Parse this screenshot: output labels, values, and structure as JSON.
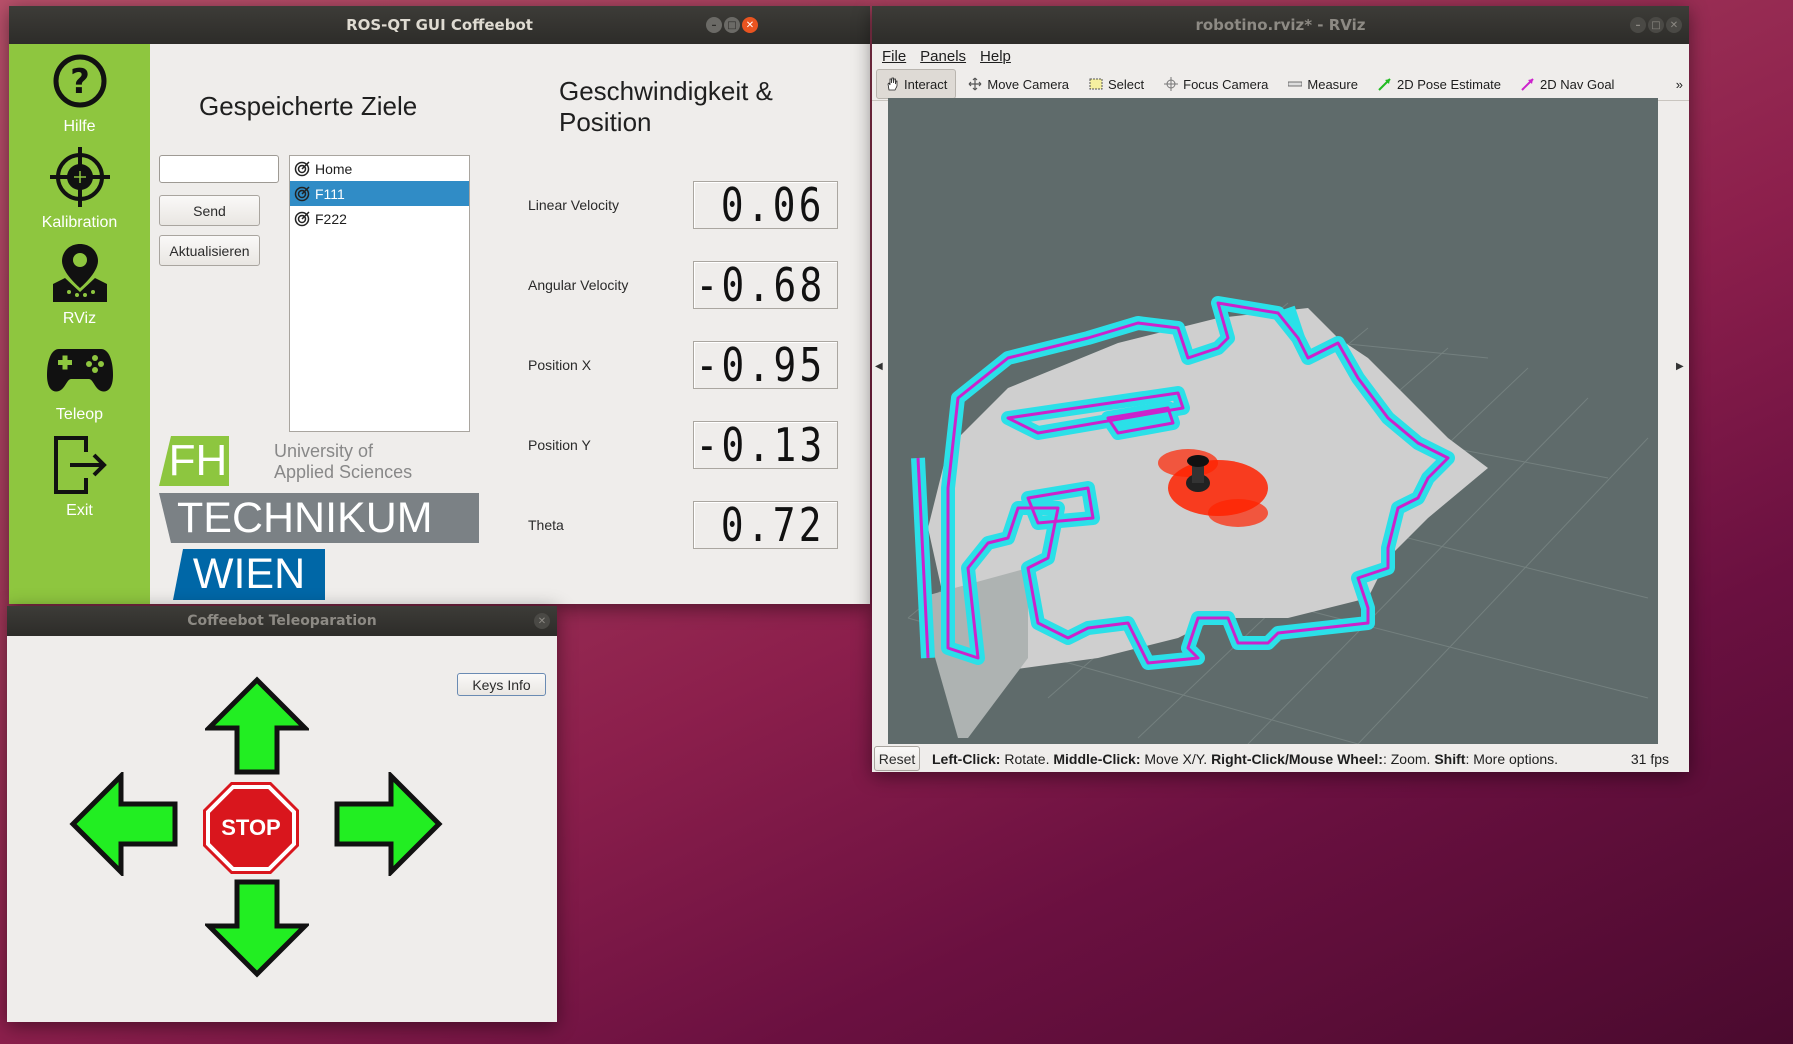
{
  "gui_window": {
    "title": "ROS-QT GUI Coffeebot",
    "sidebar": [
      {
        "label": "Hilfe",
        "icon": "help-icon"
      },
      {
        "label": "Kalibration",
        "icon": "crosshair-icon"
      },
      {
        "label": "RViz",
        "icon": "map-pin-icon"
      },
      {
        "label": "Teleop",
        "icon": "gamepad-icon"
      },
      {
        "label": "Exit",
        "icon": "exit-icon"
      }
    ],
    "goals_heading": "Gespeicherte Ziele",
    "goal_input_value": "",
    "send_label": "Send",
    "refresh_label": "Aktualisieren",
    "goals": [
      "Home",
      "F111",
      "F222"
    ],
    "selected_goal": "F111",
    "velocity_heading_line1": "Geschwindigkeit &",
    "velocity_heading_line2": "Position",
    "readouts": [
      {
        "label": "Linear Velocity",
        "value": "0.06"
      },
      {
        "label": "Angular Velocity",
        "value": "-0.68"
      },
      {
        "label": "Position X",
        "value": "-0.95"
      },
      {
        "label": "Position Y",
        "value": "-0.13"
      },
      {
        "label": "Theta",
        "value": "0.72"
      }
    ],
    "logo": {
      "fh": "FH",
      "line1": "University of",
      "line2": "Applied Sciences",
      "technikum": "TECHNIKUM",
      "wien": "WIEN"
    }
  },
  "teleop_window": {
    "title": "Coffeebot Teleoparation",
    "keys_info_label": "Keys Info",
    "stop_label": "STOP"
  },
  "rviz_window": {
    "title": "robotino.rviz* - RViz",
    "menu": [
      "File",
      "Panels",
      "Help"
    ],
    "tools": [
      "Interact",
      "Move Camera",
      "Select",
      "Focus Camera",
      "Measure",
      "2D Pose Estimate",
      "2D Nav Goal"
    ],
    "reset_label": "Reset",
    "status": {
      "left_click": "Left-Click:",
      "rotate": " Rotate.",
      "middle_click": "Middle-Click:",
      "move": " Move X/Y.",
      "right_click": "Right-Click/Mouse Wheel:",
      "zoom": ": Zoom.",
      "shift": "Shift",
      "more": ": More options."
    },
    "fps": "31 fps"
  },
  "colors": {
    "sidebar_green": "#8ec63f",
    "selection_blue": "#308cc6",
    "arrow_green": "#22ee22",
    "stop_red": "#d9161d",
    "map_cyan": "#2be0e8",
    "map_magenta": "#cc22cc",
    "laser_red": "#ff2200"
  }
}
